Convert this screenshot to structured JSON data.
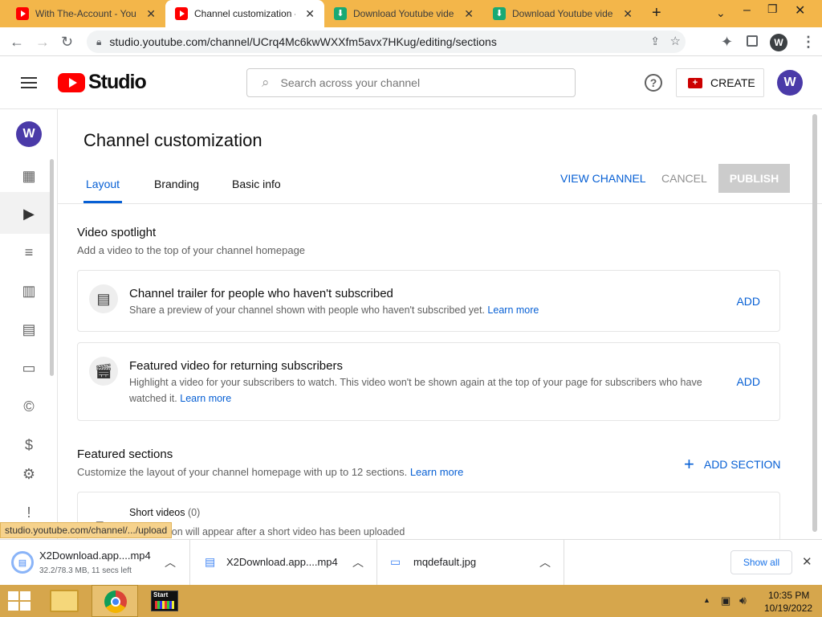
{
  "browser": {
    "tabs": [
      {
        "title": "With The-Account - YouT",
        "type": "yt",
        "active": false
      },
      {
        "title": "Channel customization -",
        "type": "yt",
        "active": true
      },
      {
        "title": "Download Youtube video",
        "type": "dl",
        "active": false
      },
      {
        "title": "Download Youtube video",
        "type": "dl",
        "active": false
      }
    ],
    "url": "studio.youtube.com/channel/UCrq4Mc6kwWXXfm5avx7HKug/editing/sections",
    "profile_initial": "W"
  },
  "header": {
    "logo_text": "Studio",
    "search_placeholder": "Search across your channel",
    "create_label": "CREATE",
    "avatar_initial": "W"
  },
  "sidenav": {
    "avatar_initial": "W",
    "items": [
      "dashboard-icon",
      "content-icon",
      "playlists-icon",
      "analytics-icon",
      "comments-icon",
      "subtitles-icon",
      "copyright-icon",
      "monetization-icon",
      "settings-icon",
      "feedback-icon"
    ]
  },
  "page": {
    "title": "Channel customization",
    "tabs": [
      "Layout",
      "Branding",
      "Basic info"
    ],
    "active_tab": "Layout",
    "actions": {
      "view_channel": "VIEW CHANNEL",
      "cancel": "CANCEL",
      "publish": "PUBLISH"
    }
  },
  "spotlight": {
    "title": "Video spotlight",
    "subtitle": "Add a video to the top of your channel homepage",
    "cards": [
      {
        "title": "Channel trailer for people who haven't subscribed",
        "desc": "Share a preview of your channel shown with people who haven't subscribed yet.",
        "link": "Learn more",
        "action": "ADD"
      },
      {
        "title": "Featured video for returning subscribers",
        "desc": "Highlight a video for your subscribers to watch. This video won't be shown again at the top of your page for subscribers who have watched it.",
        "link": "Learn more",
        "action": "ADD"
      }
    ]
  },
  "featured": {
    "title": "Featured sections",
    "subtitle": "Customize the layout of your channel homepage with up to 12 sections.",
    "link": "Learn more",
    "add_section": "ADD SECTION",
    "section_title": "Short videos",
    "section_count": "(0)",
    "section_note": "This section will appear after a short video has been uploaded"
  },
  "status_link": "studio.youtube.com/channel/.../upload",
  "downloads": {
    "items": [
      {
        "name": "X2Download.app....mp4",
        "meta": "32.2/78.3 MB, 11 secs left"
      },
      {
        "name": "X2Download.app....mp4",
        "meta": ""
      },
      {
        "name": "mqdefault.jpg",
        "meta": ""
      }
    ],
    "show_all": "Show all"
  },
  "taskbar": {
    "start_label": "Start",
    "time": "10:35 PM",
    "date": "10/19/2022"
  },
  "colors": {
    "accent": "#065fd4",
    "brand": "#ff0000",
    "avatar": "#4a3aa8"
  }
}
